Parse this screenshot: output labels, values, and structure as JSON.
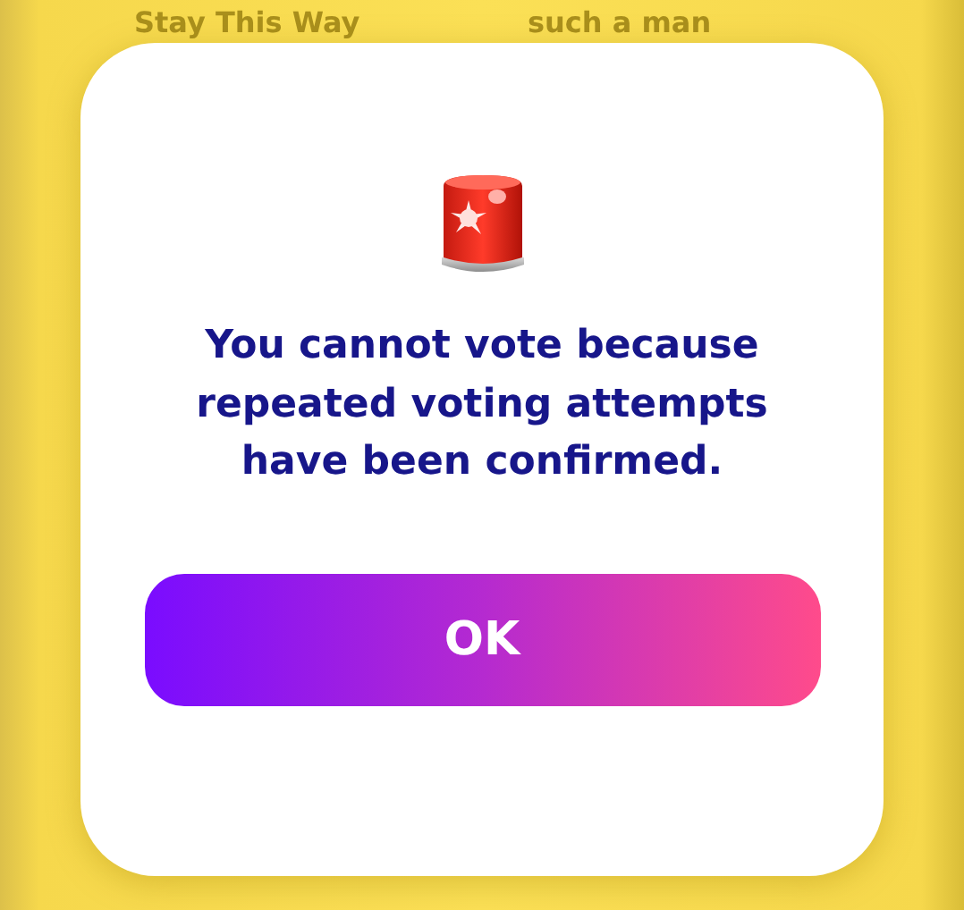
{
  "background": {
    "song_titles": [
      "Stay This Way",
      "such a man"
    ]
  },
  "dialog": {
    "message": "You cannot vote because repeated voting attempts have been confirmed.",
    "buttons": [
      "OK"
    ]
  }
}
